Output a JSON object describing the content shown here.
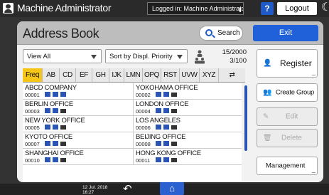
{
  "topbar": {
    "user_name": "Machine Administrator",
    "logged_in_text": "Logged in: Machine Administrator",
    "help_label": "?",
    "logout_label": "Logout"
  },
  "header": {
    "title": "Address Book",
    "search_label": "Search",
    "exit_label": "Exit"
  },
  "filters": {
    "view": "View All",
    "sort": "Sort by Displ. Priority",
    "selected_count": "15/2000",
    "page_count": "3/100"
  },
  "tabs": [
    {
      "label": "Freq",
      "active": true
    },
    {
      "label": "AB"
    },
    {
      "label": "CD"
    },
    {
      "label": "EF"
    },
    {
      "label": "GH"
    },
    {
      "label": "IJK"
    },
    {
      "label": "LMN"
    },
    {
      "label": "OPQ"
    },
    {
      "label": "RST"
    },
    {
      "label": "UVW"
    },
    {
      "label": "XYZ"
    },
    {
      "label": "⇄",
      "icon": "swap-icon"
    }
  ],
  "entries": [
    {
      "name": "ABCD COMPANY",
      "number": "00001"
    },
    {
      "name": "YOKOHAMA OFFICE",
      "number": "00002"
    },
    {
      "name": "BERLIN OFFICE",
      "number": "00003"
    },
    {
      "name": "LONDON OFFICE",
      "number": "00004"
    },
    {
      "name": "NEW YORK OFFICE",
      "number": "00005"
    },
    {
      "name": "LOS ANGELES",
      "number": "00006"
    },
    {
      "name": "KYOTO OFFICE",
      "number": "00007"
    },
    {
      "name": "BEIJING OFFICE",
      "number": "00008"
    },
    {
      "name": "SHANGHAI OFFICE",
      "number": "00010"
    },
    {
      "name": "HONG KONG OFFICE",
      "number": "00011"
    }
  ],
  "buttons": {
    "register": "Register",
    "create_group": "Create Group",
    "edit": "Edit",
    "delete": "Delete",
    "management": "Management"
  },
  "status": {
    "date": "12 Jul. 2018",
    "time": "16:27"
  },
  "colors": {
    "accent": "#2060d8",
    "active_tab": "#f5c518",
    "header_bg": "#bdbdbd"
  }
}
